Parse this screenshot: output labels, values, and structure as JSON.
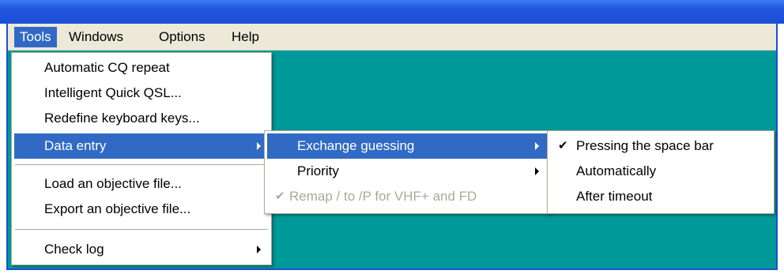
{
  "menubar": {
    "items": [
      {
        "label": "Tools"
      },
      {
        "label": "Windows"
      },
      {
        "label": "Options"
      },
      {
        "label": "Help"
      }
    ]
  },
  "tools_menu": {
    "items": [
      {
        "label": "Automatic CQ repeat"
      },
      {
        "label": "Intelligent Quick QSL..."
      },
      {
        "label": "Redefine keyboard keys..."
      },
      {
        "label": "Data entry"
      },
      {
        "label": "Load an objective file..."
      },
      {
        "label": "Export an objective file..."
      },
      {
        "label": "Check log"
      }
    ]
  },
  "data_entry_menu": {
    "items": [
      {
        "label": "Exchange guessing"
      },
      {
        "label": "Priority"
      },
      {
        "label": "Remap / to /P for VHF+ and FD"
      }
    ]
  },
  "exchange_guessing_menu": {
    "items": [
      {
        "label": "Pressing the space bar"
      },
      {
        "label": "Automatically"
      },
      {
        "label": "After timeout"
      }
    ]
  },
  "icons": {
    "check": "✔"
  },
  "colors": {
    "highlight": "#316ac5",
    "workspace": "#009999",
    "menubar": "#ece9d8",
    "disabled_text": "#aca899"
  }
}
